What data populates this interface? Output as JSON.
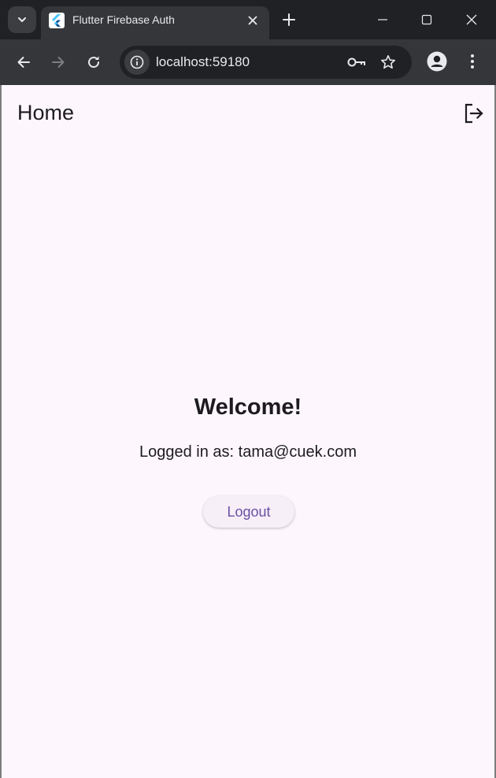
{
  "browser": {
    "tab": {
      "title": "Flutter Firebase Auth",
      "favicon": "flutter-logo-icon"
    },
    "omnibox": {
      "url": "localhost:59180"
    },
    "icons": {
      "tab_search": "chevron-down-icon",
      "tab_close": "close-icon",
      "new_tab": "plus-icon",
      "minimize": "minimize-icon",
      "maximize": "maximize-icon",
      "close_window": "close-icon",
      "back": "arrow-left-icon",
      "forward": "arrow-right-icon",
      "reload": "reload-icon",
      "site_info": "info-icon",
      "password_key": "key-icon",
      "bookmark": "star-icon",
      "profile": "profile-icon",
      "menu": "more-vertical-icon"
    },
    "colors": {
      "frame": "#202124",
      "toolbar": "#35363a",
      "text": "#e8eaed"
    }
  },
  "app": {
    "appbar": {
      "title": "Home",
      "action_icon": "logout-icon"
    },
    "body": {
      "welcome": "Welcome!",
      "logged_in_prefix": "Logged in as: ",
      "email": "tama@cuek.com",
      "logout_label": "Logout"
    },
    "colors": {
      "background": "#fdf7fd",
      "primary": "#6750a4",
      "text": "#1d1b20",
      "button_bg": "#f6eff8"
    }
  }
}
